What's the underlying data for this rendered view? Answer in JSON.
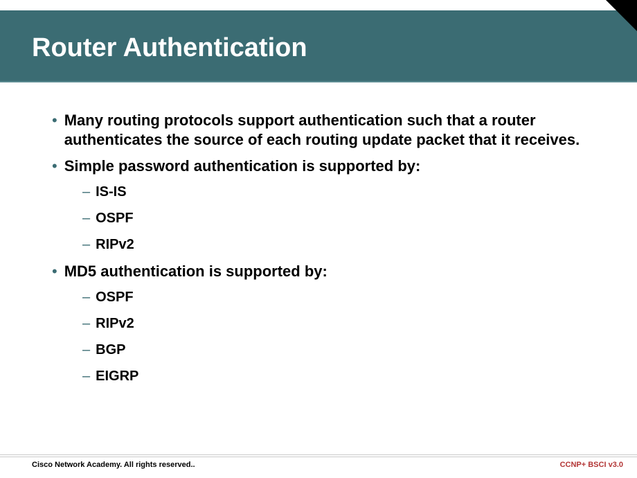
{
  "title": "Router Authentication",
  "bullets": [
    {
      "text": "Many routing protocols support authentication such that a router authenticates the source of each routing update packet that it receives.",
      "subitems": []
    },
    {
      "text": "Simple password authentication is supported by:",
      "subitems": [
        "IS-IS",
        "OSPF",
        "RIPv2"
      ]
    },
    {
      "text": "MD5 authentication is supported by:",
      "subitems": [
        "OSPF",
        "RIPv2",
        "BGP",
        "EIGRP"
      ]
    }
  ],
  "footer": {
    "left": "Cisco Network Academy. All rights reserved..",
    "right": "CCNP+ BSCI v3.0"
  }
}
